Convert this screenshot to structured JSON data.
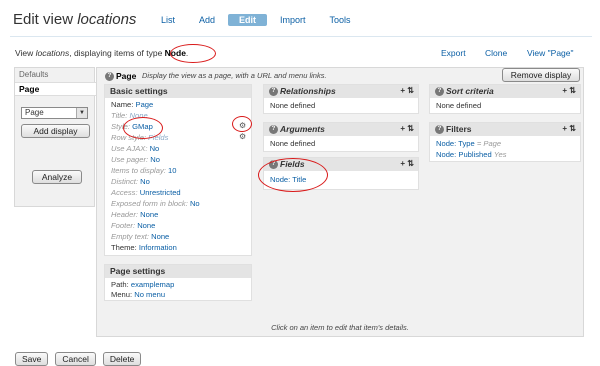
{
  "header": {
    "title_prefix": "Edit view",
    "title_view": "locations",
    "tabs": [
      {
        "label": "List",
        "active": false
      },
      {
        "label": "Add",
        "active": false
      },
      {
        "label": "Edit",
        "active": true
      },
      {
        "label": "Import",
        "active": false
      },
      {
        "label": "Tools",
        "active": false
      }
    ]
  },
  "viewline": {
    "prefix": "View",
    "view_name": "locations",
    "middle": ", displaying items of type",
    "type": "Node",
    "suffix": "."
  },
  "actions": {
    "export": "Export",
    "clone": "Clone",
    "view_page": "View \"Page\""
  },
  "sidebar": {
    "defaults": "Defaults",
    "page": "Page",
    "select_value": "Page",
    "add_display": "Add display",
    "analyze": "Analyze"
  },
  "main": {
    "page_title": "Page",
    "page_desc": "Display the view as a page, with a URL and menu links.",
    "remove_display": "Remove display",
    "basic_settings": {
      "title": "Basic settings",
      "rows": [
        {
          "label": "Name:",
          "value": "Page"
        },
        {
          "label": "Title:",
          "value": "None"
        },
        {
          "label": "Style:",
          "value": "GMap"
        },
        {
          "label": "Row style:",
          "value": "Fields"
        },
        {
          "label": "Use AJAX:",
          "value": "No"
        },
        {
          "label": "Use pager:",
          "value": "No"
        },
        {
          "label": "Items to display:",
          "value": "10"
        },
        {
          "label": "Distinct:",
          "value": "No"
        },
        {
          "label": "Access:",
          "value": "Unrestricted"
        },
        {
          "label": "Exposed form in block:",
          "value": "No"
        },
        {
          "label": "Header:",
          "value": "None"
        },
        {
          "label": "Footer:",
          "value": "None"
        },
        {
          "label": "Empty text:",
          "value": "None"
        },
        {
          "label": "Theme:",
          "value": "Information"
        }
      ]
    },
    "page_settings": {
      "title": "Page settings",
      "rows": [
        {
          "label": "Path:",
          "value": "examplemap"
        },
        {
          "label": "Menu:",
          "value": "No menu"
        }
      ]
    },
    "relationships": {
      "title": "Relationships",
      "empty": "None defined"
    },
    "arguments": {
      "title": "Arguments",
      "empty": "None defined"
    },
    "fields": {
      "title": "Fields",
      "items": [
        {
          "value": "Node: Title"
        }
      ]
    },
    "sort_criteria": {
      "title": "Sort criteria",
      "empty": "None defined"
    },
    "filters": {
      "title": "Filters",
      "rows": [
        {
          "label": "Node: Type",
          "value": "= Page"
        },
        {
          "label": "Node: Published",
          "value": "Yes"
        }
      ]
    },
    "footer_msg": "Click on an item to edit that item's details."
  },
  "bottom_buttons": {
    "save": "Save",
    "cancel": "Cancel",
    "delete": "Delete"
  },
  "icons": {
    "plus": "plus-icon",
    "rearrange": "rearrange-icon",
    "gear": "gear-icon",
    "help": "help-icon"
  },
  "colors": {
    "link": "#0b5fa5",
    "active_tab": "#7fb2d6",
    "annotation": "#d91a1a"
  }
}
